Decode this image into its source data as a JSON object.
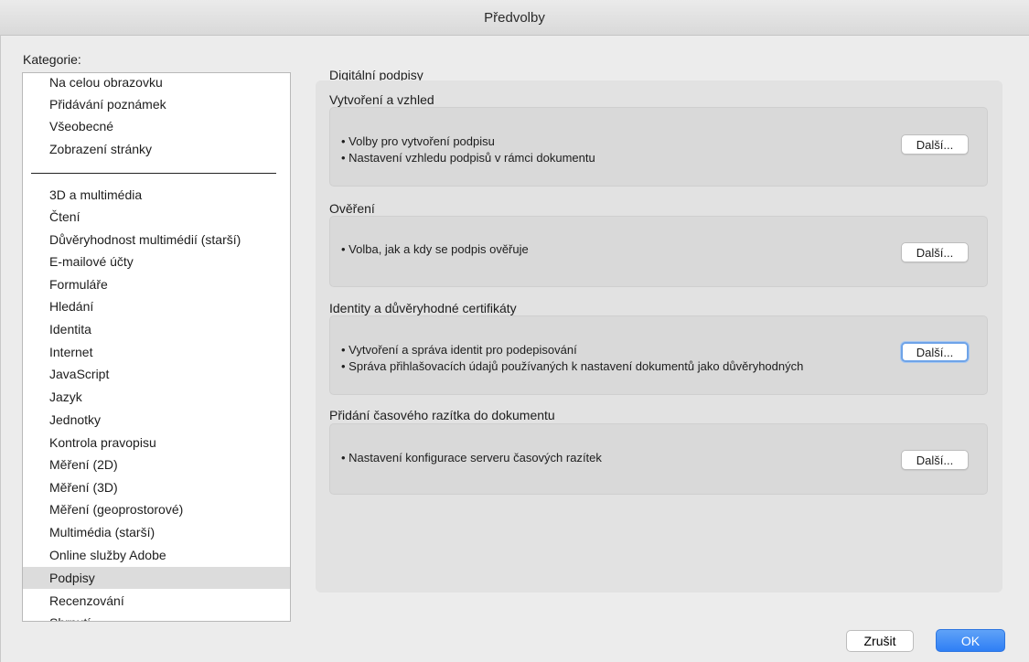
{
  "window": {
    "title": "Předvolby"
  },
  "sidebar": {
    "label": "Kategorie:",
    "top_items": [
      "Na celou obrazovku",
      "Přidávání poznámek",
      "Všeobecné",
      "Zobrazení stránky"
    ],
    "items": [
      "3D a multimédia",
      "Čtení",
      "Důvěryhodnost multimédií (starší)",
      "E-mailové účty",
      "Formuláře",
      "Hledání",
      "Identita",
      "Internet",
      "JavaScript",
      "Jazyk",
      "Jednotky",
      "Kontrola pravopisu",
      "Měření (2D)",
      "Měření (3D)",
      "Měření (geoprostorové)",
      "Multimédia (starší)",
      "Online služby Adobe",
      "Podpisy",
      "Recenzování",
      "Shrnutí"
    ],
    "selected": "Podpisy"
  },
  "main": {
    "title": "Digitální podpisy",
    "sections": [
      {
        "title": "Vytvoření a vzhled",
        "bullets": [
          "• Volby pro vytvoření podpisu",
          "• Nastavení vzhledu podpisů v rámci dokumentu"
        ],
        "button": "Další..."
      },
      {
        "title": "Ověření",
        "bullets": [
          "• Volba, jak a kdy se podpis ověřuje"
        ],
        "button": "Další..."
      },
      {
        "title": "Identity a důvěryhodné certifikáty",
        "bullets": [
          "• Vytvoření a správa identit pro podepisování",
          "• Správa přihlašovacích údajů používaných k nastavení dokumentů jako důvěryhodných"
        ],
        "button": "Další..."
      },
      {
        "title": "Přidání časového razítka do dokumentu",
        "bullets": [
          "• Nastavení konfigurace serveru časových razítek"
        ],
        "button": "Další..."
      }
    ]
  },
  "footer": {
    "cancel_label": "Zrušit",
    "ok_label": "OK"
  }
}
